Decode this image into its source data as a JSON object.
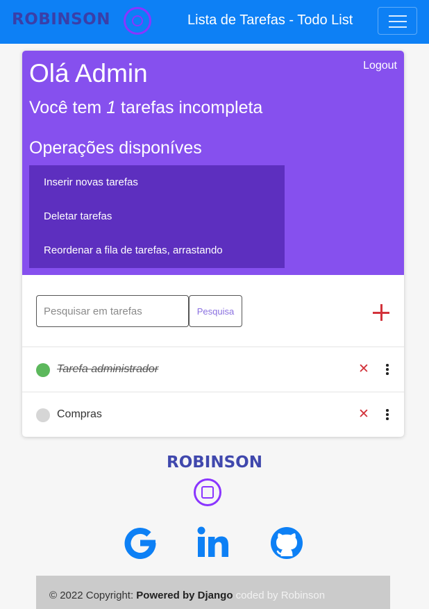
{
  "navbar": {
    "brand": "ROBINSON",
    "title": "Lista de Tarefas - Todo List",
    "menu_icon": "hamburger-icon",
    "logo_icon": "robinson-logo-icon"
  },
  "header": {
    "logout_label": "Logout",
    "greeting": "Olá Admin",
    "subtitle_prefix": "Você tem",
    "incomplete_count": "1",
    "subtitle_suffix": "tarefas incompleta",
    "operations_title": "Operações disponíves",
    "operations": [
      "Inserir novas tarefas",
      "Deletar tarefas",
      "Reordenar a fila de tarefas, arrastando"
    ]
  },
  "search": {
    "placeholder": "Pesquisar em tarefas",
    "button_label": "Pesquisa",
    "add_icon": "plus-icon"
  },
  "tasks": [
    {
      "label": "Tarefa administrador",
      "completed": true,
      "status_color": "#5cb85c"
    },
    {
      "label": "Compras",
      "completed": false,
      "status_color": "#d6d6d6"
    }
  ],
  "task_actions": {
    "delete_icon": "close-icon",
    "menu_icon": "kebab-menu-icon"
  },
  "footer": {
    "brand": "ROBINSON",
    "social_icons": [
      "google-icon",
      "linkedin-icon",
      "github-icon"
    ],
    "copyright_prefix": "© 2022 Copyright:",
    "powered_by": "Powered by Django",
    "coded_by": "coded by Robinson"
  },
  "colors": {
    "navbar": "#0d80f5",
    "header_panel": "#8650ee",
    "operations_panel": "#5d2fbf",
    "accent_red": "#d2323a",
    "brand": "#4048ad",
    "social_blue": "#0d80f5"
  }
}
